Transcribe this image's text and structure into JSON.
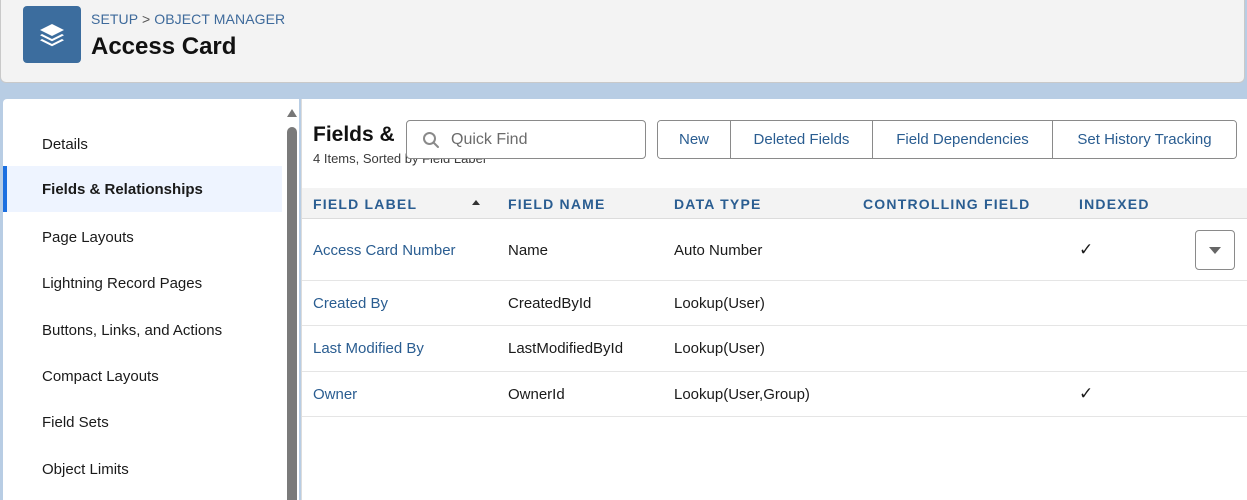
{
  "header": {
    "breadcrumb": {
      "setup": "SETUP",
      "sep": ">",
      "object_manager": "OBJECT MANAGER"
    },
    "title": "Access Card",
    "icon": "layers-icon",
    "icon_color": "#3c6d9e"
  },
  "sidebar": {
    "items": [
      {
        "label": "Details"
      },
      {
        "label": "Fields & Relationships",
        "active": true
      },
      {
        "label": "Page Layouts"
      },
      {
        "label": "Lightning Record Pages"
      },
      {
        "label": "Buttons, Links, and Actions"
      },
      {
        "label": "Compact Layouts"
      },
      {
        "label": "Field Sets"
      },
      {
        "label": "Object Limits"
      }
    ]
  },
  "main": {
    "section_title": "Fields &",
    "section_subtitle": "4 Items, Sorted by Field Label",
    "search": {
      "placeholder": "Quick Find",
      "value": ""
    },
    "buttons": {
      "new": "New",
      "deleted_fields": "Deleted Fields",
      "field_dependencies": "Field Dependencies",
      "set_history_tracking": "Set History Tracking"
    },
    "columns": {
      "field_label": "FIELD LABEL",
      "field_name": "FIELD NAME",
      "data_type": "DATA TYPE",
      "controlling_field": "CONTROLLING FIELD",
      "indexed": "INDEXED"
    },
    "rows": [
      {
        "label": "Access Card Number",
        "name": "Name",
        "type": "Auto Number",
        "controlling": "",
        "indexed": "✓"
      },
      {
        "label": "Created By",
        "name": "CreatedById",
        "type": "Lookup(User)",
        "controlling": "",
        "indexed": ""
      },
      {
        "label": "Last Modified By",
        "name": "LastModifiedById",
        "type": "Lookup(User)",
        "controlling": "",
        "indexed": ""
      },
      {
        "label": "Owner",
        "name": "OwnerId",
        "type": "Lookup(User,Group)",
        "controlling": "",
        "indexed": "✓"
      }
    ]
  },
  "colors": {
    "link": "#2a5d91",
    "accent": "#1b6fe0",
    "background": "#b8cde4"
  }
}
